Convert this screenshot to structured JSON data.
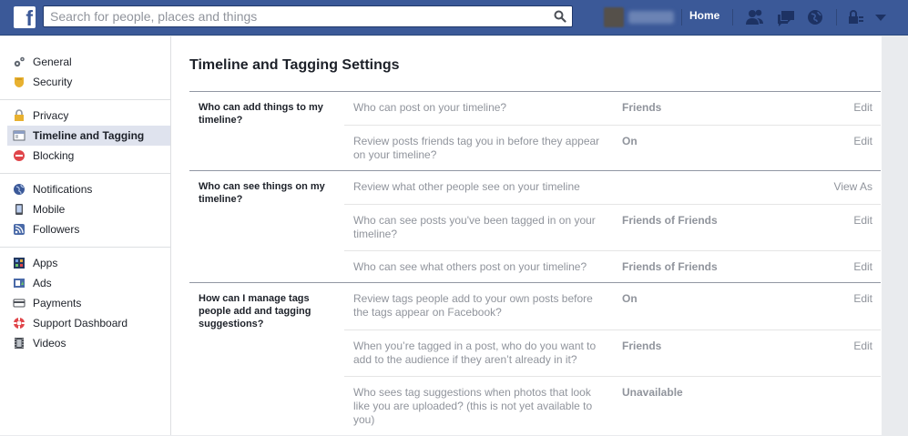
{
  "header": {
    "logo": "f",
    "search_placeholder": "Search for people, places and things",
    "home_label": "Home"
  },
  "sidebar": {
    "groups": [
      [
        {
          "label": "General",
          "icon": "gear-icon"
        },
        {
          "label": "Security",
          "icon": "shield-icon"
        }
      ],
      [
        {
          "label": "Privacy",
          "icon": "lock-icon"
        },
        {
          "label": "Timeline and Tagging",
          "icon": "timeline-icon",
          "active": true
        },
        {
          "label": "Blocking",
          "icon": "block-icon"
        }
      ],
      [
        {
          "label": "Notifications",
          "icon": "globe-icon"
        },
        {
          "label": "Mobile",
          "icon": "mobile-icon"
        },
        {
          "label": "Followers",
          "icon": "rss-icon"
        }
      ],
      [
        {
          "label": "Apps",
          "icon": "apps-icon"
        },
        {
          "label": "Ads",
          "icon": "ads-icon"
        },
        {
          "label": "Payments",
          "icon": "card-icon"
        },
        {
          "label": "Support Dashboard",
          "icon": "lifebuoy-icon"
        },
        {
          "label": "Videos",
          "icon": "film-icon"
        }
      ]
    ]
  },
  "main": {
    "title": "Timeline and Tagging Settings",
    "sections": [
      {
        "title": "Who can add things to my timeline?",
        "rows": [
          {
            "label": "Who can post on your timeline?",
            "value": "Friends",
            "action": "Edit"
          },
          {
            "label": "Review posts friends tag you in before they appear on your timeline?",
            "value": "On",
            "action": "Edit"
          }
        ]
      },
      {
        "title": "Who can see things on my timeline?",
        "rows": [
          {
            "label": "Review what other people see on your timeline",
            "value": "",
            "action": "View As"
          },
          {
            "label": "Who can see posts you've been tagged in on your timeline?",
            "value": "Friends of Friends",
            "action": "Edit"
          },
          {
            "label": "Who can see what others post on your timeline?",
            "value": "Friends of Friends",
            "action": "Edit"
          }
        ]
      },
      {
        "title": "How can I manage tags people add and tagging suggestions?",
        "rows": [
          {
            "label": "Review tags people add to your own posts before the tags appear on Facebook?",
            "value": "On",
            "action": "Edit"
          },
          {
            "label": "When you’re tagged in a post, who do you want to add to the audience if they aren’t already in it?",
            "value": "Friends",
            "action": "Edit"
          },
          {
            "label": "Who sees tag suggestions when photos that look like you are uploaded? (this is not yet available to you)",
            "value": "Unavailable",
            "action": ""
          }
        ]
      }
    ]
  },
  "colors": {
    "brand_blue": "#3b5998",
    "active_bg": "#dfe3ee",
    "muted_text": "#90949c"
  }
}
